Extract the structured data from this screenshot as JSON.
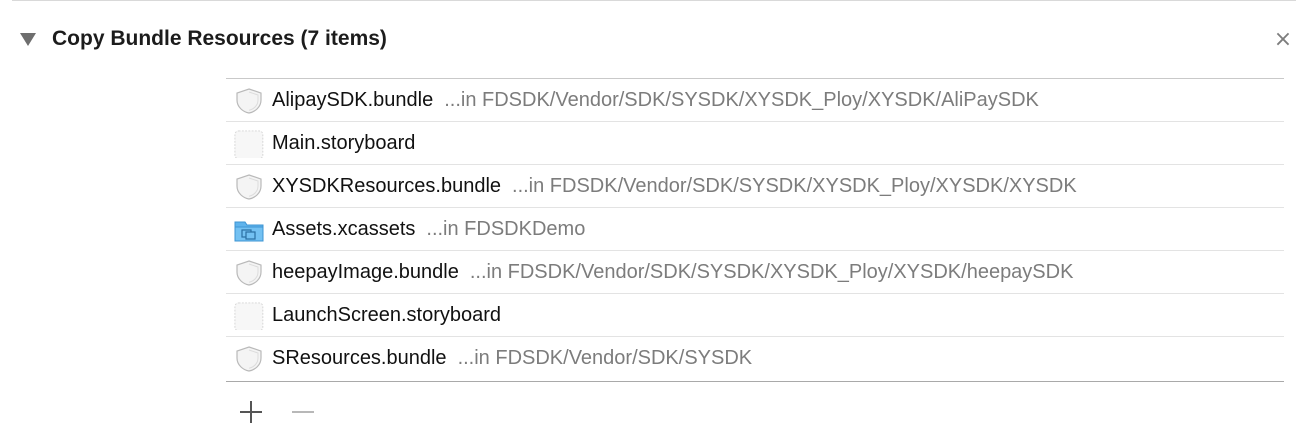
{
  "phase": {
    "title": "Copy Bundle Resources (7 items)",
    "close_glyph": "×"
  },
  "files": [
    {
      "name": "AlipaySDK.bundle",
      "path": "...in FDSDK/Vendor/SDK/SYSDK/XYSDK_Ploy/XYSDK/AliPaySDK",
      "icon": "bundle-icon"
    },
    {
      "name": "Main.storyboard",
      "path": "",
      "icon": "storyboard-file-icon"
    },
    {
      "name": "XYSDKResources.bundle",
      "path": "...in FDSDK/Vendor/SDK/SYSDK/XYSDK_Ploy/XYSDK/XYSDK",
      "icon": "bundle-icon"
    },
    {
      "name": "Assets.xcassets",
      "path": "...in FDSDKDemo",
      "icon": "asset-catalog-folder-icon"
    },
    {
      "name": "heepayImage.bundle",
      "path": "...in FDSDK/Vendor/SDK/SYSDK/XYSDK_Ploy/XYSDK/heepaySDK",
      "icon": "bundle-icon"
    },
    {
      "name": "LaunchScreen.storyboard",
      "path": "",
      "icon": "storyboard-file-icon"
    },
    {
      "name": "SResources.bundle",
      "path": "...in FDSDK/Vendor/SDK/SYSDK",
      "icon": "bundle-icon"
    }
  ],
  "toolbar": {
    "add_icon": "plus-icon",
    "remove_icon": "minus-icon"
  },
  "colors": {
    "folder_blue": "#5fb3ec",
    "path_gray": "#7c7c7c",
    "title_black": "#1c1c1c"
  }
}
